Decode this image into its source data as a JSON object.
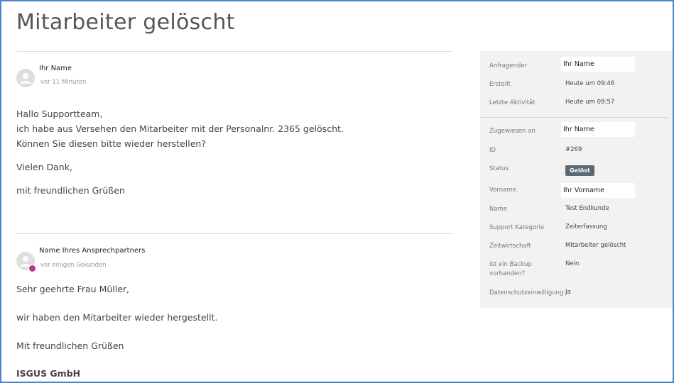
{
  "ticket": {
    "title": "Mitarbeiter gelöscht"
  },
  "messages": [
    {
      "author": "Ihr Name",
      "time": "vor 11 Minuten",
      "lines": [
        "Hallo Supportteam,",
        "ich habe aus Versehen den Mitarbeiter mit der Personalnr. 2365 gelöscht.",
        "Können Sie diesen bitte wieder herstellen?"
      ],
      "thanks": "Vielen Dank,",
      "closing": "mit freundlichen Grüßen"
    },
    {
      "author": "Name Ihres Ansprechpartners",
      "time": "vor einigen Sekunden",
      "greeting": "Sehr geehrte Frau Müller,",
      "text": "wir haben den Mitarbeiter wieder hergestellt.",
      "closing": "Mit freundlichen Grüßen",
      "signature": "ISGUS GmbH"
    }
  ],
  "sidebar": {
    "requester": {
      "label": "Anfragender",
      "value": "Ihr Name"
    },
    "created": {
      "label": "Erstellt",
      "value": "Heute um 09:46"
    },
    "last_activity": {
      "label": "Letzte Aktivität",
      "value": "Heute um 09:57"
    },
    "assignee": {
      "label": "Zugewiesen an",
      "value": "Ihr Name"
    },
    "id": {
      "label": "ID",
      "value": "#269"
    },
    "status": {
      "label": "Status",
      "value": "Gelöst",
      "color": "#5d6875"
    },
    "first_name": {
      "label": "Vorname",
      "value": "Ihr Vorname"
    },
    "name": {
      "label": "Name",
      "value": "Test Endkunde"
    },
    "support_category": {
      "label": "Support Kategorie",
      "value": "Zeiterfassung"
    },
    "time_management": {
      "label": "Zeitwirtschaft",
      "value": "Mitarbeiter gelöscht"
    },
    "backup": {
      "label": "Ist ein Backup vorhanden?",
      "value": "Nein"
    },
    "privacy_consent": {
      "label": "Datenschutzeinwilligung",
      "value": "Ja"
    }
  },
  "colors": {
    "frame_border": "#4a86c8",
    "presence": "#b3378a",
    "sidebar_bg": "#f2f2f2"
  }
}
